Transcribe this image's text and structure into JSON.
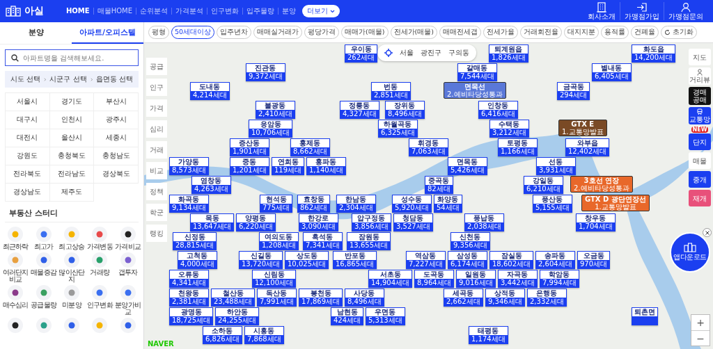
{
  "header": {
    "logo": "아실",
    "nav": [
      {
        "label": "HOME",
        "selected": true
      },
      {
        "label": "매물HOME",
        "selected": false
      },
      {
        "label": "순위분석",
        "selected": false
      },
      {
        "label": "가격분석",
        "selected": false
      },
      {
        "label": "인구변화",
        "selected": false
      },
      {
        "label": "입주물량",
        "selected": false
      },
      {
        "label": "분양",
        "selected": false
      }
    ],
    "more_button": "더보기",
    "links": [
      {
        "label": "회사소개",
        "kind": "building"
      },
      {
        "label": "가맹점가입",
        "kind": "login"
      },
      {
        "label": "가맹점문의",
        "kind": "person"
      }
    ]
  },
  "sidebar": {
    "tabs": [
      {
        "label": "분양",
        "selected": false
      },
      {
        "label": "아파트/오피스텔",
        "selected": true
      }
    ],
    "search": {
      "placeholder": "아파트명을 검색해보세요."
    },
    "breadcrumb": [
      "시도 선택",
      "시군구 선택",
      "읍면동 선택"
    ],
    "regions": [
      "서울시",
      "경기도",
      "부산시",
      "대구시",
      "인천시",
      "광주시",
      "대전시",
      "울산시",
      "세종시",
      "강원도",
      "충청북도",
      "충청남도",
      "전라북도",
      "전라남도",
      "경상북도",
      "경상남도",
      "제주도"
    ],
    "study": {
      "title": "부동산 스터디",
      "items": [
        {
          "label": "최근하락",
          "color": "#f5b400"
        },
        {
          "label": "최고가",
          "color": "#3a6ff0"
        },
        {
          "label": "최고상승",
          "color": "#f5b400"
        },
        {
          "label": "가격변동",
          "color": "#e84a4a"
        },
        {
          "label": "가격비교",
          "color": "#222222"
        },
        {
          "label": "여러단지비교",
          "color": "#e8a040"
        },
        {
          "label": "매물증감",
          "color": "#2f5fe8"
        },
        {
          "label": "많이산단지",
          "color": "#2f5fe8"
        },
        {
          "label": "거래량",
          "color": "#27a06a"
        },
        {
          "label": "갭투자",
          "color": "#7a5fd0"
        },
        {
          "label": "매수심리",
          "color": "#8a3a8a"
        },
        {
          "label": "공급물량",
          "color": "#3aa060"
        },
        {
          "label": "미분양",
          "color": "#9a9a9a"
        },
        {
          "label": "인구변화",
          "color": "#3a6ff0"
        },
        {
          "label": "분양가비교",
          "color": "#3a6ff0"
        },
        {
          "color": "#222222"
        },
        {
          "color": "#2aa08a"
        },
        {
          "color": "#2f5fe8"
        },
        {
          "color": "#f5b400"
        },
        {
          "color": "#2f5fe8"
        }
      ]
    }
  },
  "filters": {
    "chips": [
      {
        "label": "평형",
        "selected": false
      },
      {
        "label": "50세대이상",
        "selected": true
      },
      {
        "label": "입주년차",
        "selected": false
      },
      {
        "label": "매매실거래가",
        "selected": false
      },
      {
        "label": "평당가격",
        "selected": false
      },
      {
        "label": "매매가(매물)",
        "selected": false
      },
      {
        "label": "전세가(매물)",
        "selected": false
      },
      {
        "label": "매매전세갭",
        "selected": false
      },
      {
        "label": "전세가율",
        "selected": false
      },
      {
        "label": "거래회전율",
        "selected": false
      },
      {
        "label": "대지지분",
        "selected": false
      },
      {
        "label": "용적률",
        "selected": false
      },
      {
        "label": "건폐율",
        "selected": false
      }
    ],
    "reset": "초기화"
  },
  "map": {
    "location": [
      "서울",
      "광진구",
      "구의동"
    ],
    "side_menu": [
      "공급",
      "인구",
      "가격",
      "심리",
      "거래",
      "비교",
      "정책",
      "학군",
      "랭킹"
    ],
    "markers": [
      {
        "name": "우이동",
        "count": "262세대"
      },
      {
        "name": "퇴계원읍",
        "count": "1,826세대"
      },
      {
        "name": "화도읍",
        "count": "14,200세대"
      },
      {
        "name": "진관동",
        "count": "9,372세대"
      },
      {
        "name": "갈매동",
        "count": "7,544세대"
      },
      {
        "name": "별내동",
        "count": "6,405세대"
      },
      {
        "name": "도내동",
        "count": "4,214세대"
      },
      {
        "name": "번동",
        "count": "2,851세대"
      },
      {
        "name": "금곡동",
        "count": "294세대"
      },
      {
        "name": "불광동",
        "count": "2,410세대"
      },
      {
        "name": "정릉동",
        "count": "4,327세대"
      },
      {
        "name": "장위동",
        "count": "8,496세대"
      },
      {
        "name": "인창동",
        "count": "6,416세대"
      },
      {
        "name": "응암동",
        "count": "10,706세대"
      },
      {
        "name": "하월곡동",
        "count": "6,325세대"
      },
      {
        "name": "수택동",
        "count": "3,212세대"
      },
      {
        "name": "증산동",
        "count": "1,901세대"
      },
      {
        "name": "홍제동",
        "count": "8,662세대"
      },
      {
        "name": "휘경동",
        "count": "7,063세대"
      },
      {
        "name": "토평동",
        "count": "1,166세대"
      },
      {
        "name": "와부읍",
        "count": "12,402세대"
      },
      {
        "name": "가양동",
        "count": "8,573세대"
      },
      {
        "name": "중동",
        "count": "1,201세대"
      },
      {
        "name": "연희동",
        "count": "119세대"
      },
      {
        "name": "홍파동",
        "count": "1,140세대"
      },
      {
        "name": "면목동",
        "count": "5,426세대"
      },
      {
        "name": "선동",
        "count": "3,931세대"
      },
      {
        "name": "염창동",
        "count": "4,263세대"
      },
      {
        "name": "중곡동",
        "count": "82세대"
      },
      {
        "name": "강일동",
        "count": "6,210세대"
      },
      {
        "name": "화곡동",
        "count": "9,134세대"
      },
      {
        "name": "현석동",
        "count": "775세대"
      },
      {
        "name": "효창동",
        "count": "862세대"
      },
      {
        "name": "한남동",
        "count": "2,304세대"
      },
      {
        "name": "성수동",
        "count": "5,920세대"
      },
      {
        "name": "화양동",
        "count": "54세대"
      },
      {
        "name": "풍산동",
        "count": "5,155세대"
      },
      {
        "name": "목동",
        "count": "13,647세대"
      },
      {
        "name": "양평동",
        "count": "6,220세대"
      },
      {
        "name": "한강로",
        "count": "3,090세대"
      },
      {
        "name": "압구정동",
        "count": "3,856세대"
      },
      {
        "name": "청담동",
        "count": "3,527세대"
      },
      {
        "name": "풍납동",
        "count": "2,038세대"
      },
      {
        "name": "창우동",
        "count": "1,704세대"
      },
      {
        "name": "신정동",
        "count": "28,815세대"
      },
      {
        "name": "여의도동",
        "count": "1,208세대"
      },
      {
        "name": "흑석동",
        "count": "7,341세대"
      },
      {
        "name": "잠원동",
        "count": "13,655세대"
      },
      {
        "name": "신천동",
        "count": "9,356세대"
      },
      {
        "name": "고척동",
        "count": "4,000세대"
      },
      {
        "name": "신길동",
        "count": "13,720세대"
      },
      {
        "name": "상도동",
        "count": "10,025세대"
      },
      {
        "name": "반포동",
        "count": "16,865세대"
      },
      {
        "name": "역삼동",
        "count": "7,227세대"
      },
      {
        "name": "삼성동",
        "count": "6,174세대"
      },
      {
        "name": "잠실동",
        "count": "18,602세대"
      },
      {
        "name": "송파동",
        "count": "2,604세대"
      },
      {
        "name": "오금동",
        "count": "970세대"
      },
      {
        "name": "오류동",
        "count": "4,341세대"
      },
      {
        "name": "신림동",
        "count": "12,100세대"
      },
      {
        "name": "서초동",
        "count": "14,904세대"
      },
      {
        "name": "도곡동",
        "count": "8,964세대"
      },
      {
        "name": "일원동",
        "count": "9,016세대"
      },
      {
        "name": "자곡동",
        "count": "3,442세대"
      },
      {
        "name": "학암동",
        "count": "7,994세대"
      },
      {
        "name": "천왕동",
        "count": "2,381세대"
      },
      {
        "name": "철산동",
        "count": "23,488세대"
      },
      {
        "name": "독산동",
        "count": "7,991세대"
      },
      {
        "name": "봉천동",
        "count": "17,869세대"
      },
      {
        "name": "사당동",
        "count": "8,496세대"
      },
      {
        "name": "세곡동",
        "count": "2,662세대"
      },
      {
        "name": "상적동",
        "count": "9,346세대"
      },
      {
        "name": "은행동",
        "count": "2,332세대"
      },
      {
        "name": "광명동",
        "count": "18,725세대"
      },
      {
        "name": "하안동",
        "count": "24,255세대"
      },
      {
        "name": "남현동",
        "count": "424세대"
      },
      {
        "name": "우면동",
        "count": "5,313세대"
      },
      {
        "name": "퇴촌면"
      },
      {
        "name": "소하동",
        "count": "6,826세대"
      },
      {
        "name": "시흥동",
        "count": "7,868세대"
      },
      {
        "name": "태평동",
        "count": "1,174세대"
      }
    ],
    "transit": [
      {
        "line": "면목선",
        "stage": "2.예비타당성통과",
        "color": "#5a78d8"
      },
      {
        "line": "GTX E",
        "stage": "1.교통망발표",
        "color": "#7a4a25"
      },
      {
        "line": "3호선 연장",
        "stage": "2.예비타당성통과",
        "color": "#e8682a"
      },
      {
        "line": "GTX D 광단연장선",
        "stage": "1.교통망발표",
        "color": "#e8682a"
      }
    ],
    "controls": [
      {
        "label": "지도",
        "kind": "plain"
      },
      {
        "label": "거리뷰",
        "kind": "icon"
      },
      {
        "label": "경매공매",
        "kind": "dark"
      },
      {
        "label": "교통망",
        "kind": "primary_icon"
      },
      {
        "label": "단지",
        "kind": "primary",
        "badge": "NEW"
      },
      {
        "label": "매물",
        "kind": "plain"
      },
      {
        "label": "중개",
        "kind": "primary"
      },
      {
        "label": "재개",
        "kind": "pink"
      }
    ],
    "app_download": "앱다운로드",
    "zoom": [
      "+",
      "−"
    ],
    "logo": "NAVER"
  }
}
